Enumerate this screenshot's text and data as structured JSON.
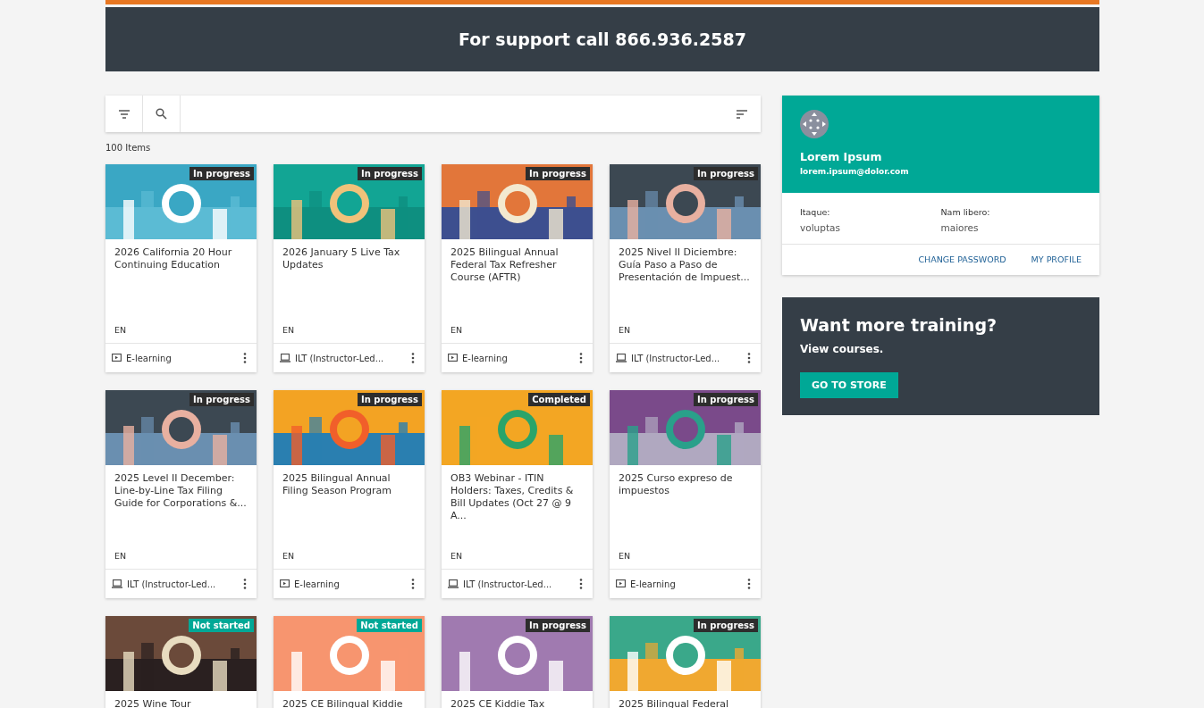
{
  "support_banner": {
    "text": "For support call 866.936.2587"
  },
  "item_count": "100 Items",
  "courses": [
    {
      "title": "2026 California 20 Hour Continuing Education",
      "language": "EN",
      "status": {
        "label": "In progress",
        "kind": "active"
      },
      "type": {
        "label": "E-learning",
        "kind": "video"
      }
    },
    {
      "title": "2026 January 5 Live Tax Updates",
      "language": "EN",
      "status": {
        "label": "In progress",
        "kind": "active"
      },
      "type": {
        "label": "ILT (Instructor-Led...",
        "kind": "classroom"
      }
    },
    {
      "title": "2025 Bilingual Annual Federal Tax Refresher Course (AFTR)",
      "language": "EN",
      "status": {
        "label": "In progress",
        "kind": "active"
      },
      "type": {
        "label": "E-learning",
        "kind": "video"
      }
    },
    {
      "title": "2025 Nivel II Diciembre: Guía Paso a Paso de Presentación de Impuest...",
      "language": "EN",
      "status": {
        "label": "In progress",
        "kind": "active"
      },
      "type": {
        "label": "ILT (Instructor-Led...",
        "kind": "classroom"
      }
    },
    {
      "title": "2025 Level II December: Line-by-Line Tax Filing Guide for Corporations &...",
      "language": "EN",
      "status": {
        "label": "In progress",
        "kind": "active"
      },
      "type": {
        "label": "ILT (Instructor-Led...",
        "kind": "classroom"
      }
    },
    {
      "title": "2025 Bilingual Annual Filing Season Program",
      "language": "EN",
      "status": {
        "label": "In progress",
        "kind": "active"
      },
      "type": {
        "label": "E-learning",
        "kind": "video"
      }
    },
    {
      "title": "OB3 Webinar - ITIN Holders: Taxes, Credits & Bill Updates (Oct 27 @ 9 A...",
      "language": "EN",
      "status": {
        "label": "Completed",
        "kind": "done"
      },
      "type": {
        "label": "ILT (Instructor-Led...",
        "kind": "classroom"
      }
    },
    {
      "title": "2025 Curso expreso de impuestos",
      "language": "EN",
      "status": {
        "label": "In progress",
        "kind": "active"
      },
      "type": {
        "label": "E-learning",
        "kind": "video"
      }
    },
    {
      "title": "2025 Wine Tour",
      "status": {
        "label": "Not started",
        "kind": "new"
      }
    },
    {
      "title": "2025 CE Bilingual Kiddie",
      "status": {
        "label": "Not started",
        "kind": "new"
      }
    },
    {
      "title": "2025 CE Kiddie Tax",
      "status": {
        "label": "In progress",
        "kind": "active"
      }
    },
    {
      "title": "2025 Bilingual Federal",
      "status": {
        "label": "In progress",
        "kind": "active"
      }
    }
  ],
  "profile": {
    "name": "Lorem Ipsum",
    "email": "lorem.ipsum@dolor.com",
    "fields": [
      {
        "label": "Itaque:",
        "value": "voluptas"
      },
      {
        "label": "Nam libero:",
        "value": "maiores"
      }
    ],
    "actions": [
      "CHANGE PASSWORD",
      "MY PROFILE"
    ]
  },
  "promo": {
    "title": "Want more training?",
    "subtitle": "View courses.",
    "button": "GO TO STORE"
  }
}
